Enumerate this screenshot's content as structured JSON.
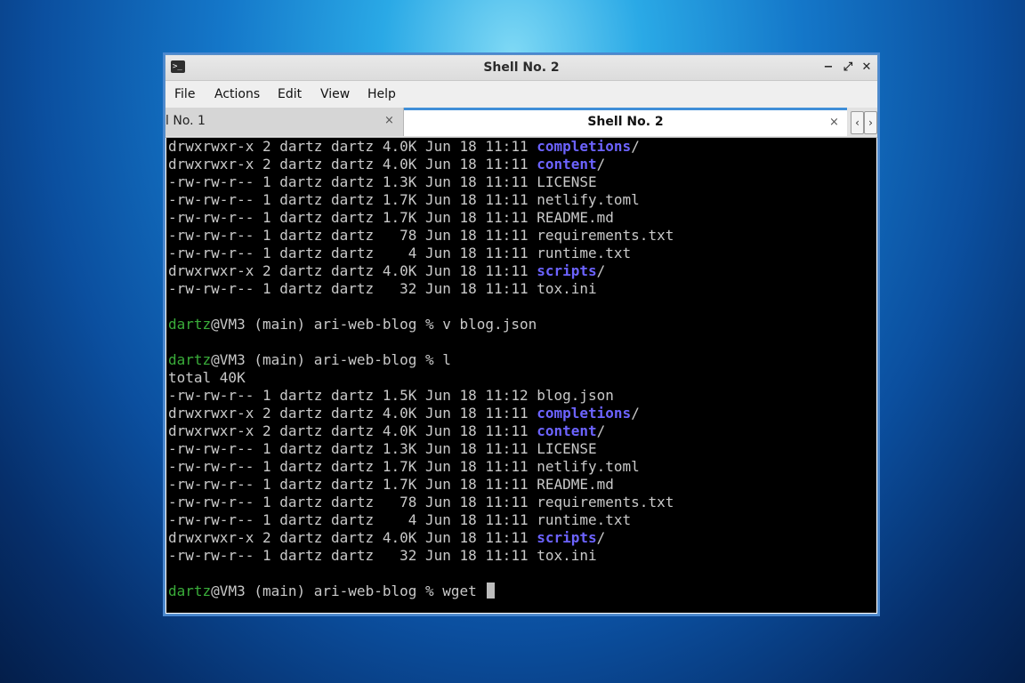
{
  "window": {
    "title": "Shell No. 2",
    "controls": {
      "minimize": "−",
      "maximize": "⤢",
      "close": "✕"
    }
  },
  "menu": [
    "File",
    "Actions",
    "Edit",
    "View",
    "Help"
  ],
  "tabs": [
    {
      "label": "l No. 1",
      "active": false,
      "close": "×"
    },
    {
      "label": "Shell No. 2",
      "active": true,
      "close": "×"
    }
  ],
  "tab_scroll": {
    "left": "‹",
    "right": "›"
  },
  "terminal": {
    "lines": [
      [
        {
          "t": "drwxrwxr-x 2 dartz dartz 4.0K Jun 18 11:11 "
        },
        {
          "t": "completions",
          "c": "dir"
        },
        {
          "t": "/"
        }
      ],
      [
        {
          "t": "drwxrwxr-x 2 dartz dartz 4.0K Jun 18 11:11 "
        },
        {
          "t": "content",
          "c": "dir"
        },
        {
          "t": "/"
        }
      ],
      [
        {
          "t": "-rw-rw-r-- 1 dartz dartz 1.3K Jun 18 11:11 LICENSE"
        }
      ],
      [
        {
          "t": "-rw-rw-r-- 1 dartz dartz 1.7K Jun 18 11:11 netlify.toml"
        }
      ],
      [
        {
          "t": "-rw-rw-r-- 1 dartz dartz 1.7K Jun 18 11:11 README.md"
        }
      ],
      [
        {
          "t": "-rw-rw-r-- 1 dartz dartz   78 Jun 18 11:11 requirements.txt"
        }
      ],
      [
        {
          "t": "-rw-rw-r-- 1 dartz dartz    4 Jun 18 11:11 runtime.txt"
        }
      ],
      [
        {
          "t": "drwxrwxr-x 2 dartz dartz 4.0K Jun 18 11:11 "
        },
        {
          "t": "scripts",
          "c": "dir"
        },
        {
          "t": "/"
        }
      ],
      [
        {
          "t": "-rw-rw-r-- 1 dartz dartz   32 Jun 18 11:11 tox.ini"
        }
      ],
      [],
      [
        {
          "t": "dartz",
          "c": "user"
        },
        {
          "t": "@VM3 (main) ari-web-blog % v blog.json"
        }
      ],
      [],
      [
        {
          "t": "dartz",
          "c": "user"
        },
        {
          "t": "@VM3 (main) ari-web-blog % l"
        }
      ],
      [
        {
          "t": "total 40K"
        }
      ],
      [
        {
          "t": "-rw-rw-r-- 1 dartz dartz 1.5K Jun 18 11:12 blog.json"
        }
      ],
      [
        {
          "t": "drwxrwxr-x 2 dartz dartz 4.0K Jun 18 11:11 "
        },
        {
          "t": "completions",
          "c": "dir"
        },
        {
          "t": "/"
        }
      ],
      [
        {
          "t": "drwxrwxr-x 2 dartz dartz 4.0K Jun 18 11:11 "
        },
        {
          "t": "content",
          "c": "dir"
        },
        {
          "t": "/"
        }
      ],
      [
        {
          "t": "-rw-rw-r-- 1 dartz dartz 1.3K Jun 18 11:11 LICENSE"
        }
      ],
      [
        {
          "t": "-rw-rw-r-- 1 dartz dartz 1.7K Jun 18 11:11 netlify.toml"
        }
      ],
      [
        {
          "t": "-rw-rw-r-- 1 dartz dartz 1.7K Jun 18 11:11 README.md"
        }
      ],
      [
        {
          "t": "-rw-rw-r-- 1 dartz dartz   78 Jun 18 11:11 requirements.txt"
        }
      ],
      [
        {
          "t": "-rw-rw-r-- 1 dartz dartz    4 Jun 18 11:11 runtime.txt"
        }
      ],
      [
        {
          "t": "drwxrwxr-x 2 dartz dartz 4.0K Jun 18 11:11 "
        },
        {
          "t": "scripts",
          "c": "dir"
        },
        {
          "t": "/"
        }
      ],
      [
        {
          "t": "-rw-rw-r-- 1 dartz dartz   32 Jun 18 11:11 tox.ini"
        }
      ],
      [],
      [
        {
          "t": "dartz",
          "c": "user"
        },
        {
          "t": "@VM3 (main) ari-web-blog % wget "
        }
      ]
    ]
  },
  "colors": {
    "directory": "#6c63ff",
    "user": "#3aad3a",
    "text": "#c9c9c9",
    "accent": "#3f8ed8"
  }
}
